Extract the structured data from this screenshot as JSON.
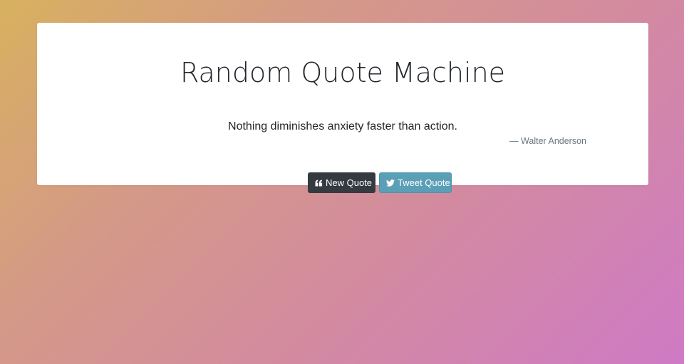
{
  "app": {
    "title": "Random Quote Machine"
  },
  "quote": {
    "text": "Nothing diminishes anxiety faster than action.",
    "author": "— Walter Anderson"
  },
  "buttons": {
    "new_quote": {
      "label": "New Quote",
      "icon": "quote-left-icon"
    },
    "tweet_quote": {
      "label": "Tweet Quote",
      "icon": "twitter-icon"
    }
  },
  "colors": {
    "new_quote_bg": "#343a40",
    "tweet_quote_bg": "#5a9fb6",
    "background_start": "#d8b15f",
    "background_end": "#cf7ac5"
  }
}
